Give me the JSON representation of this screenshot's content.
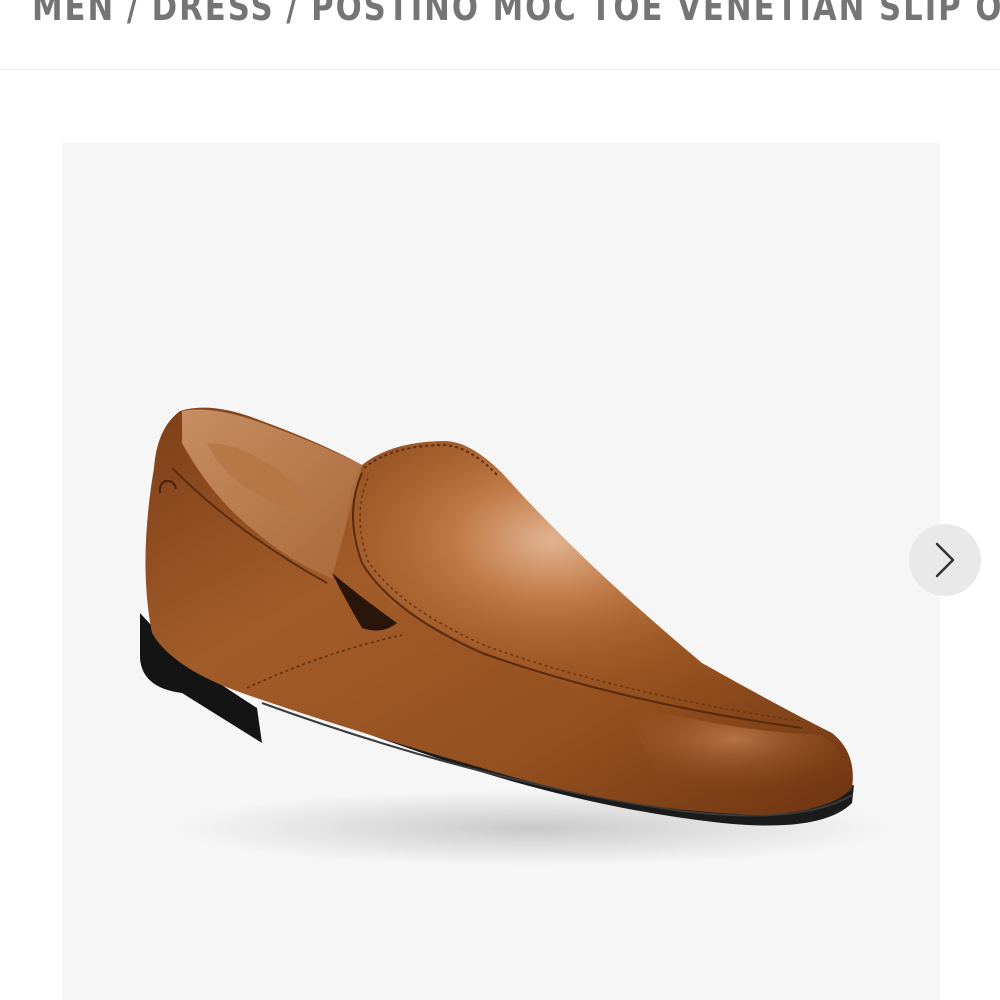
{
  "breadcrumb": {
    "items": [
      "MEN",
      "DRESS",
      "POSTINO MOC TOE VENETIAN SLIP ON"
    ],
    "separator": "/"
  },
  "gallery": {
    "product_image": "brown-leather-venetian-slip-on-shoe",
    "next_icon": "chevron-right-icon",
    "background": "#f6f6f6"
  },
  "colors": {
    "breadcrumb_text": "#757575",
    "leather": "#9a5527",
    "sole": "#161616"
  }
}
